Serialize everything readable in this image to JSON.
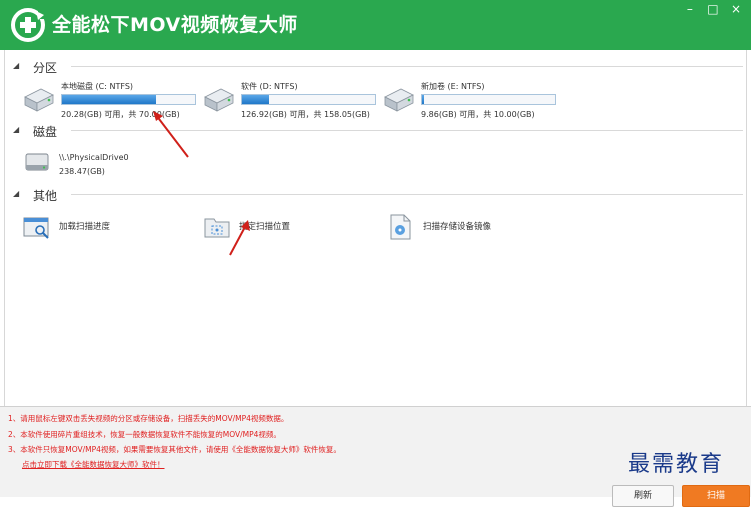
{
  "window": {
    "title": "全能松下MOV视频恢复大师",
    "minimize": "–",
    "restore": "□",
    "close": "×"
  },
  "sections": {
    "partition": "分区",
    "disk": "磁盘",
    "other": "其他"
  },
  "partitions": [
    {
      "name": "本地磁盘 (C: NTFS)",
      "info": "20.28(GB) 可用，共 70.00(GB)",
      "used_fraction": 0.71
    },
    {
      "name": "软件 (D: NTFS)",
      "info": "126.92(GB) 可用，共 158.05(GB)",
      "used_fraction": 0.2
    },
    {
      "name": "新加卷 (E: NTFS)",
      "info": "9.86(GB) 可用，共 10.00(GB)",
      "used_fraction": 0.014
    }
  ],
  "disks": [
    {
      "name": "\\\\.\\PhysicalDrive0",
      "size": "238.47(GB)"
    }
  ],
  "others": [
    {
      "label": "加载扫描进度",
      "icon": "load-scan-progress-icon"
    },
    {
      "label": "指定扫描位置",
      "icon": "specify-scan-location-icon"
    },
    {
      "label": "扫描存储设备镜像",
      "icon": "scan-device-image-icon"
    }
  ],
  "notes": [
    "1、请用鼠标左键双击丢失视频的分区或存储设备，扫描丢失的MOV/MP4视频数据。",
    "2、本软件使用碎片重组技术，恢复一般数据恢复软件不能恢复的MOV/MP4视频。",
    "3、本软件只恢复MOV/MP4视频，如果需要恢复其他文件，请使用《全能数据恢复大师》软件恢复。"
  ],
  "download_link": "点击立即下载《全能数据恢复大师》软件！",
  "watermark": "最需教育",
  "buttons": {
    "refresh": "刷新",
    "scan": "扫描"
  },
  "colors": {
    "title_bar": "#2aa84f",
    "progress_fill": "#1f77c8",
    "note_text": "#e02020",
    "scan_button": "#f07a22",
    "annotation_arrow": "#d0201a"
  }
}
